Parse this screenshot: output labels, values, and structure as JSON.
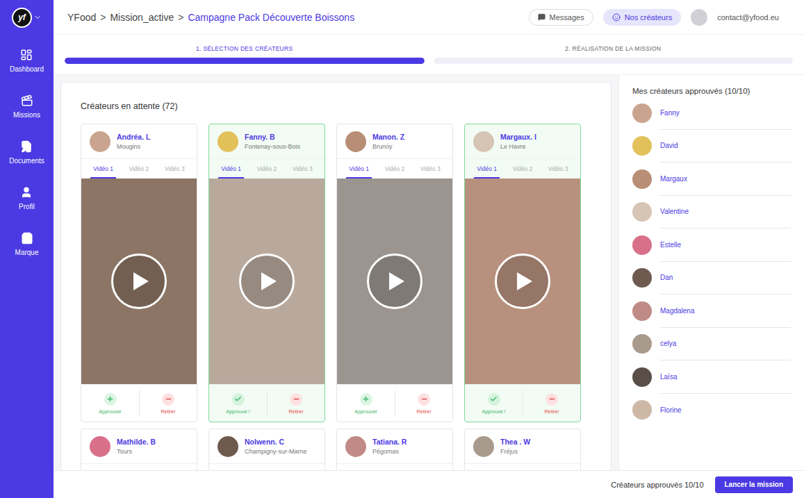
{
  "logo": {
    "text": "yf"
  },
  "sidebar": {
    "items": [
      {
        "label": "Dashboard"
      },
      {
        "label": "Missions"
      },
      {
        "label": "Documents"
      },
      {
        "label": "Profil"
      },
      {
        "label": "Marque"
      }
    ]
  },
  "breadcrumb": {
    "separator": ">",
    "items": [
      {
        "label": "YFood",
        "current": false
      },
      {
        "label": "Mission_active",
        "current": false
      },
      {
        "label": "Campagne Pack Découverte Boissons",
        "current": true
      }
    ]
  },
  "header": {
    "messages": "Messages",
    "creators": "Nos créateurs",
    "email": "contact@yfood.eu"
  },
  "steps": [
    {
      "label": "1. SÉLECTION DES CRÉATEURS",
      "level": 1
    },
    {
      "label": "2. RÉALISATION DE LA MISSION",
      "level": 0
    }
  ],
  "pending": {
    "title": "Créateurs en attente (72)",
    "cards": [
      {
        "kind": "full",
        "name": "Andréa. L",
        "city": "Mougins",
        "approved": false,
        "approve_label": "Approuver",
        "remove_label": "Retirer",
        "tabs": [
          {
            "label": "Vidéo 1",
            "selected": true
          },
          {
            "label": "Vidéo 2",
            "selected": false
          },
          {
            "label": "Vidéo 3",
            "selected": false
          }
        ]
      },
      {
        "kind": "full",
        "name": "Fanny. B",
        "city": "Fontenay-sous-Bois",
        "approved": true,
        "approve_label": "Approuvé !",
        "remove_label": "Retirer",
        "tabs": [
          {
            "label": "Vidéo 1",
            "selected": true
          },
          {
            "label": "Vidéo 2",
            "selected": false
          },
          {
            "label": "Vidéo 3",
            "selected": false
          }
        ]
      },
      {
        "kind": "full",
        "name": "Manon. Z",
        "city": "Brunoy",
        "approved": false,
        "approve_label": "Approuver",
        "remove_label": "Retirer",
        "tabs": [
          {
            "label": "Vidéo 1",
            "selected": true
          },
          {
            "label": "Vidéo 2",
            "selected": false
          },
          {
            "label": "Vidéo 3",
            "selected": false
          }
        ]
      },
      {
        "kind": "full",
        "name": "Margaux. I",
        "city": "Le Havre",
        "approved": true,
        "approve_label": "Approuvé !",
        "remove_label": "Retirer",
        "tabs": [
          {
            "label": "Vidéo 1",
            "selected": true
          },
          {
            "label": "Vidéo 2",
            "selected": false
          },
          {
            "label": "Vidéo 3",
            "selected": false
          }
        ]
      },
      {
        "kind": "clipped",
        "name": "Mathilde. B",
        "city": "Tours",
        "approved": false
      },
      {
        "kind": "clipped",
        "name": "Nolwenn. C",
        "city": "Champigny-sur-Marne",
        "approved": false
      },
      {
        "kind": "clipped",
        "name": "Tatiana. R",
        "city": "Pégomas",
        "approved": false
      },
      {
        "kind": "clipped",
        "name": "Thea . W",
        "city": "Fréjus",
        "approved": false
      }
    ]
  },
  "approved": {
    "title": "Mes créateurs approuvés (10/10)",
    "creators": [
      {
        "name": "Fanny"
      },
      {
        "name": "David"
      },
      {
        "name": "Margaux"
      },
      {
        "name": "Valentine"
      },
      {
        "name": "Estelle"
      },
      {
        "name": "Dan"
      },
      {
        "name": "Magdalena"
      },
      {
        "name": "celya"
      },
      {
        "name": "Laïsa"
      },
      {
        "name": "Florine"
      }
    ]
  },
  "footer": {
    "count": "Créateurs approuvés 10/10",
    "button": "Lancer la mission"
  }
}
